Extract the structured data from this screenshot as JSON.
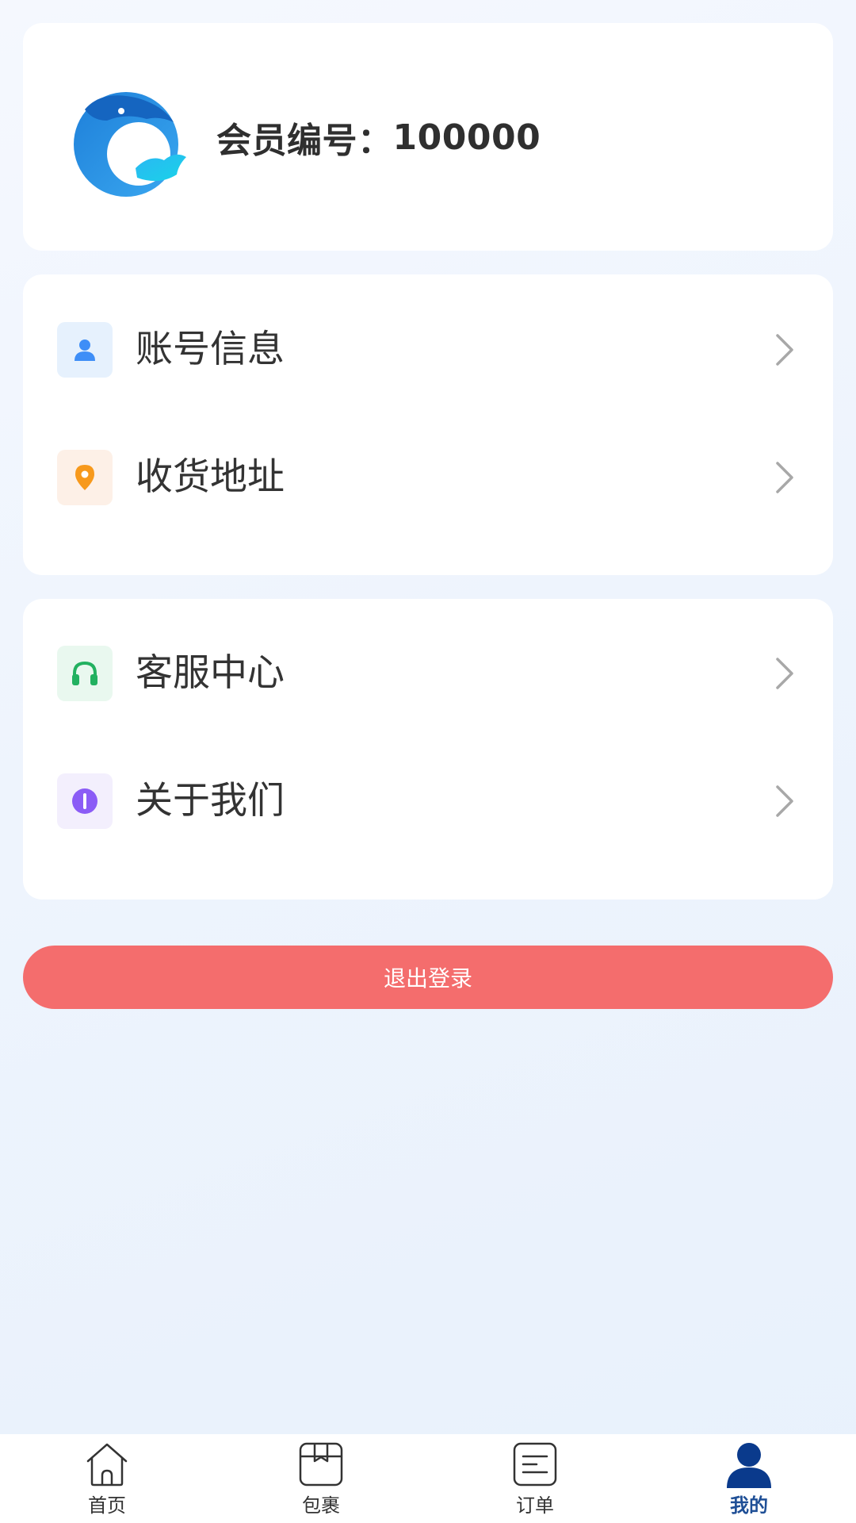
{
  "profile": {
    "member_label": "会员编号：",
    "member_id": "100000",
    "logo_icon": "dolphin-logo"
  },
  "menu_group_1": [
    {
      "label": "账号信息",
      "icon": "user-icon",
      "icon_color": "#3e8ef7",
      "icon_bg": "#e6f1fd"
    },
    {
      "label": "收货地址",
      "icon": "location-pin-icon",
      "icon_color": "#f7991c",
      "icon_bg": "#fdf0e7"
    }
  ],
  "menu_group_2": [
    {
      "label": "客服中心",
      "icon": "headset-icon",
      "icon_color": "#22b160",
      "icon_bg": "#e9f8ef"
    },
    {
      "label": "关于我们",
      "icon": "info-icon",
      "icon_color": "#8b5cf6",
      "icon_bg": "#f3effd"
    }
  ],
  "logout": {
    "label": "退出登录",
    "color": "#f46d6d"
  },
  "tabbar": {
    "active_color": "#1f4f96",
    "items": [
      {
        "label": "首页",
        "icon": "home-icon"
      },
      {
        "label": "包裹",
        "icon": "package-icon"
      },
      {
        "label": "订单",
        "icon": "order-list-icon"
      },
      {
        "label": "我的",
        "icon": "profile-icon",
        "active": true
      }
    ]
  }
}
